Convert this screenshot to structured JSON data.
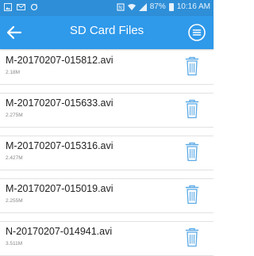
{
  "status_bar": {
    "carrier_icons": [
      "image-icon",
      "mail-icon",
      "sync-icon"
    ],
    "battery": "87%",
    "time": "10:16 AM"
  },
  "header": {
    "title": "SD Card Files"
  },
  "files": [
    {
      "name": "M-20170207-015812.avi",
      "size": "2.18M"
    },
    {
      "name": "M-20170207-015633.avi",
      "size": "2.275M"
    },
    {
      "name": "M-20170207-015316.avi",
      "size": "2.427M"
    },
    {
      "name": "M-20170207-015019.avi",
      "size": "2.255M"
    },
    {
      "name": "N-20170207-014941.avi",
      "size": "3.511M"
    }
  ],
  "colors": {
    "status_bar": "#2e8fd8",
    "app_bar": "#2f99ea",
    "trash_icon": "#5aa9e6"
  }
}
